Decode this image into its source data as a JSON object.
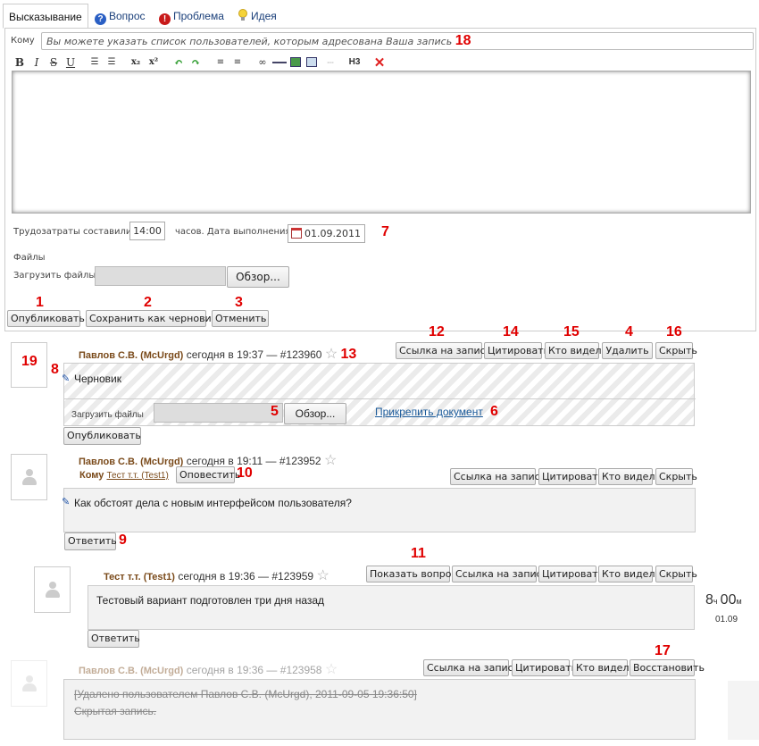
{
  "tabs": [
    {
      "label": "Высказывание",
      "icon": "none"
    },
    {
      "label": "Вопрос",
      "icon": "question-icon"
    },
    {
      "label": "Проблема",
      "icon": "exclamation-icon"
    },
    {
      "label": "Идея",
      "icon": "lightbulb-icon"
    }
  ],
  "form": {
    "to_label": "Кому",
    "to_placeholder": "Вы можете указать список пользователей, которым адресована Ваша запись",
    "toolbar": [
      "bold",
      "italic",
      "strike",
      "underline",
      "outdent",
      "indent",
      "subscript",
      "superscript",
      "undo",
      "redo",
      "ordered-list",
      "unordered-list",
      "link",
      "hr",
      "image",
      "table",
      "dotted",
      "h3",
      "clear"
    ],
    "h3_label": "H3",
    "effort_label": "Трудозатраты составили",
    "effort_value": "14:00",
    "date_label": "часов. Дата выполнения",
    "date_value": "01.09.2011",
    "files_label": "Файлы",
    "upload_label": "Загрузить файлы",
    "browse_label": "Обзор...",
    "publish_label": "Опубликовать",
    "draft_label": "Сохранить как черновик",
    "cancel_label": "Отменить"
  },
  "markers": {
    "m1": "1",
    "m2": "2",
    "m3": "3",
    "m4": "4",
    "m5": "5",
    "m6": "6",
    "m7": "7",
    "m8": "8",
    "m9": "9",
    "m10": "10",
    "m11": "11",
    "m12": "12",
    "m13": "13",
    "m14": "14",
    "m15": "15",
    "m16": "16",
    "m17": "17",
    "m18": "18",
    "m19": "19"
  },
  "posts": {
    "draft": {
      "author": "Павлов С.В. (McUrgd)",
      "meta": "сегодня в 19:37 — #123960",
      "btn_link": "Ссылка на запись",
      "btn_quote": "Цитировать",
      "btn_seen": "Кто видел?",
      "btn_delete": "Удалить",
      "btn_hide": "Скрыть",
      "text": "Черновик",
      "upload_label": "Загрузить файлы",
      "browse_label": "Обзор...",
      "attach_label": "Прикрепить документ",
      "publish_label": "Опубликовать"
    },
    "p2": {
      "author": "Павлов С.В. (McUrgd)",
      "meta": "сегодня в 19:11 — #123952",
      "to_label": "Кому",
      "to_user": "Тест т.т. (Test1)",
      "notify_label": "Оповестить",
      "btn_link": "Ссылка на запись",
      "btn_quote": "Цитировать",
      "btn_seen": "Кто видел?",
      "btn_hide": "Скрыть",
      "text": "Как обстоят дела с новым интерфейсом пользователя?",
      "reply_label": "Ответить"
    },
    "p3": {
      "author": "Тест т.т. (Test1)",
      "meta": "сегодня в 19:36 — #123959",
      "btn_show": "Показать вопрос",
      "btn_link": "Ссылка на запись",
      "btn_quote": "Цитировать",
      "btn_seen": "Кто видел?",
      "btn_hide": "Скрыть",
      "text": "Тестовый вариант подготовлен три дня назад",
      "reply_label": "Ответить",
      "hours": "8",
      "hours_unit": "ч",
      "minutes": "00",
      "minutes_unit": "м",
      "date": "01.09"
    },
    "p4": {
      "author": "Павлов С.В. (McUrgd)",
      "meta": "сегодня в 19:36 — #123958",
      "btn_link": "Ссылка на запись",
      "btn_quote": "Цитировать",
      "btn_seen": "Кто видел?",
      "btn_restore": "Восстановить",
      "deleted_line": "[Удалено пользователем Павлов С.В. (McUrgd), 2011-09-05 19:36:50]",
      "hidden_line": "Скрытая запись."
    }
  }
}
